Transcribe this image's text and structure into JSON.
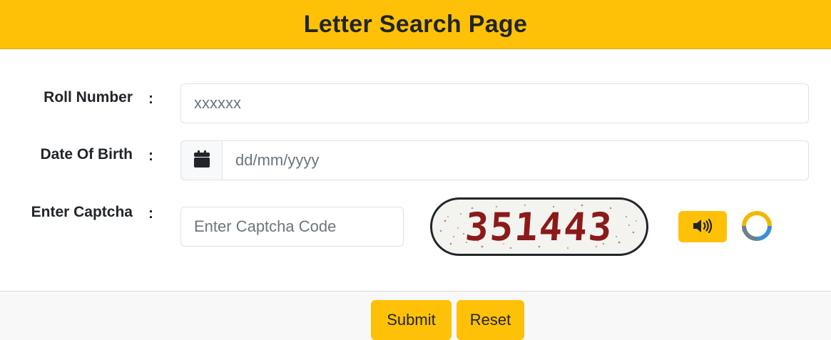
{
  "header": {
    "title": "Letter Search Page"
  },
  "form": {
    "colon": ":",
    "roll_number": {
      "label": "Roll Number",
      "value": "xxxxxx"
    },
    "dob": {
      "label": "Date Of Birth",
      "placeholder": "dd/mm/yyyy",
      "icon": "calendar-icon"
    },
    "captcha": {
      "label": "Enter Captcha",
      "placeholder": "Enter Captcha Code",
      "image_text": "351443",
      "audio_icon": "speaker-icon",
      "refresh_icon": "refresh-icon"
    }
  },
  "footer": {
    "submit_label": "Submit",
    "reset_label": "Reset"
  },
  "colors": {
    "accent": "#ffc107",
    "text": "#212529",
    "captcha_text": "#8b1a1a"
  }
}
